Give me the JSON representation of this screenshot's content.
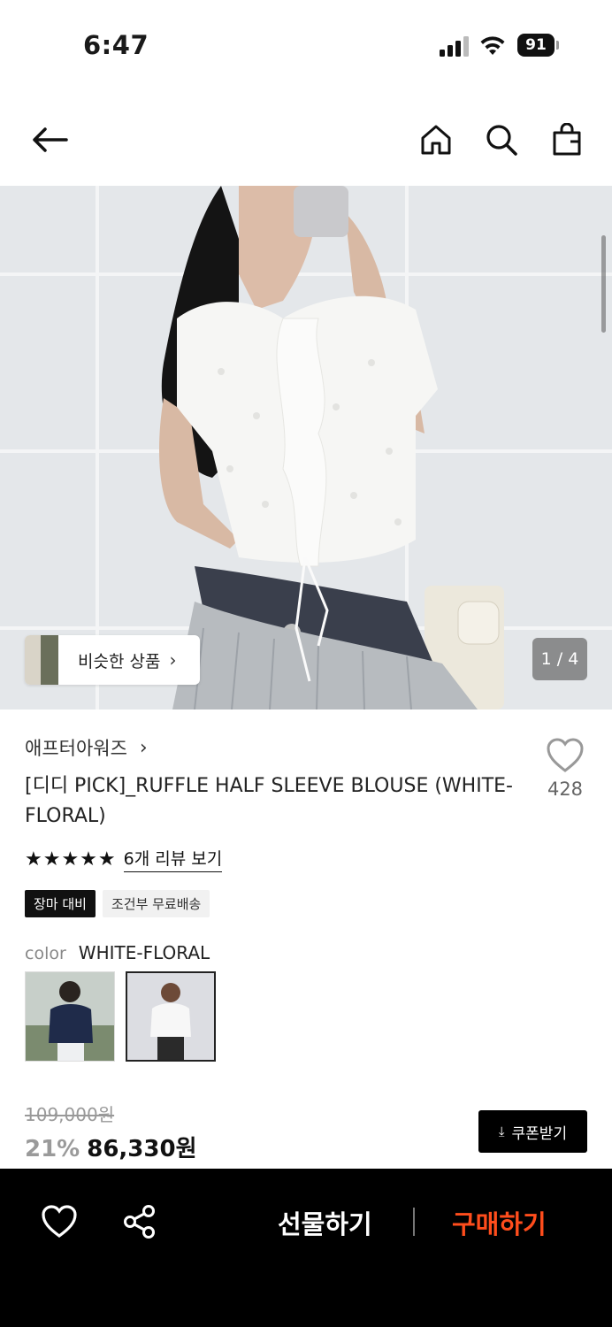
{
  "status_bar": {
    "time": "6:47",
    "battery": "91"
  },
  "nav": {
    "back": "back-arrow-icon",
    "home": "home-icon",
    "search": "search-icon",
    "cart": "shopping-bag-icon"
  },
  "hero": {
    "similar_label": "비슷한 상품",
    "counter": "1 / 4"
  },
  "product": {
    "brand": "애프터아워즈",
    "title": "[디디 PICK]_RUFFLE HALF SLEEVE BLOUSE (WHITE-FLORAL)",
    "likes": "428",
    "rating_stars": 5,
    "stars_text": "★★★★★",
    "review_link": "6개 리뷰 보기",
    "tags": [
      "장마 대비",
      "조건부 무료배송"
    ],
    "color_label": "color",
    "color_value": "WHITE-FLORAL"
  },
  "price": {
    "original": "109,000원",
    "discount": "21%",
    "final": "86,330원",
    "coupon": "쿠폰받기"
  },
  "bottom_bar": {
    "gift": "선물하기",
    "buy": "구매하기"
  },
  "colors": {
    "buy_accent": "#ff4d1c",
    "dark": "#111111"
  }
}
